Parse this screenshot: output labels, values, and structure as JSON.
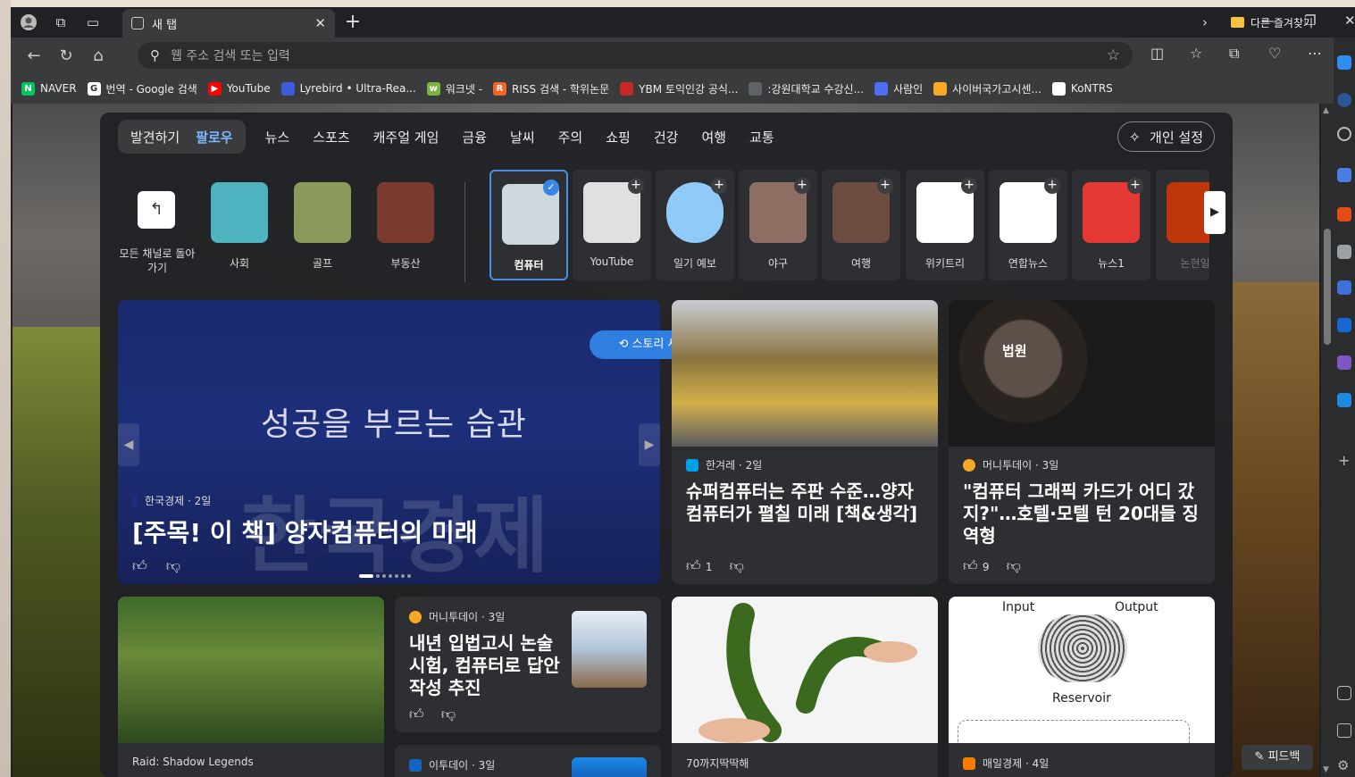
{
  "tab": {
    "title": "새 탭",
    "close": "✕",
    "new": "+"
  },
  "window": {
    "min": "—",
    "max": "❐",
    "close": "✕"
  },
  "omnibox": {
    "placeholder": "웹 주소 검색 또는 입력"
  },
  "favorites": [
    {
      "label": "NAVER",
      "icon_text": "N",
      "color": "#03c75a"
    },
    {
      "label": "번역 - Google 검색",
      "icon_text": "G",
      "color": "#ffffff"
    },
    {
      "label": "YouTube",
      "icon_text": "▶",
      "color": "#ff0000"
    },
    {
      "label": "Lyrebird • Ultra-Rea...",
      "icon_text": "",
      "color": "#3b5bdb"
    },
    {
      "label": "워크넷 -",
      "icon_text": "w",
      "color": "#7cb342"
    },
    {
      "label": "RISS 검색 - 학위논문",
      "icon_text": "R",
      "color": "#f26522"
    },
    {
      "label": "YBM 토익인강 공식...",
      "icon_text": "",
      "color": "#c62828"
    },
    {
      "label": ":강원대학교 수강신...",
      "icon_text": "",
      "color": "#5f6368"
    },
    {
      "label": "사람인",
      "icon_text": "",
      "color": "#4c6ef5"
    },
    {
      "label": "사이버국가고시센...",
      "icon_text": "",
      "color": "#f9a825"
    },
    {
      "label": "KoNTRS",
      "icon_text": "",
      "color": "#ffffff"
    }
  ],
  "favorites_other": "다른 즐겨찾기",
  "nav": {
    "discover": "발견하기",
    "follow": "팔로우",
    "categories": [
      "뉴스",
      "스포츠",
      "캐주얼 게임",
      "금융",
      "날씨",
      "주의",
      "쇼핑",
      "건강",
      "여행",
      "교통"
    ],
    "personalize": "개인 설정"
  },
  "channels": {
    "back_label": "모든 채널로 돌아가기",
    "followed": [
      {
        "label": "사회",
        "color": "#4fb3bf"
      },
      {
        "label": "골프",
        "color": "#8a9a5b"
      },
      {
        "label": "부동산",
        "color": "#7a3b2e"
      }
    ],
    "suggested": [
      {
        "label": "컴퓨터",
        "color": "#cfd8dc",
        "selected": true
      },
      {
        "label": "YouTube",
        "color": "#e0e0e0",
        "selected": false
      },
      {
        "label": "일기 예보",
        "color": "#90caf9",
        "selected": false
      },
      {
        "label": "야구",
        "color": "#8d6e63",
        "selected": false
      },
      {
        "label": "여행",
        "color": "#6d4c41",
        "selected": false
      },
      {
        "label": "위키트리",
        "color": "#ffffff",
        "selected": false
      },
      {
        "label": "연합뉴스",
        "color": "#ffffff",
        "selected": false
      },
      {
        "label": "뉴스1",
        "color": "#e53935",
        "selected": false
      },
      {
        "label": "논현일",
        "color": "#bf360c",
        "selected": false
      }
    ]
  },
  "hero": {
    "image_text": "성공을 부르는 습관",
    "bg_text": "한국경제",
    "source": "한국경제 · 2일",
    "title": "[주목! 이 책] 양자컴퓨터의 미래",
    "refresh": "스토리 새로 고침"
  },
  "cards": [
    {
      "source": "한겨레 · 2일",
      "title": "슈퍼컴퓨터는 주판 수준…양자컴퓨터가 펼칠 미래 [책&생각]",
      "likes": "1",
      "icon_color": "#00a0e9"
    },
    {
      "source": "머니투데이 · 3일",
      "title": "\"컴퓨터 그래픽 카드가 어디 갔지?\"…호텔·모텔 턴 20대들 징역형",
      "likes": "9",
      "icon_color": "#f9a825",
      "image_text": "법원"
    },
    {
      "source": "Raid: Shadow Legends",
      "title": ""
    },
    {
      "source": "머니투데이 · 3일",
      "title": "내년 입법고시 논술시험, 컴퓨터로 답안작성 추진",
      "icon_color": "#f9a825"
    },
    {
      "source": "70까지딱딱해",
      "title": ""
    },
    {
      "source": "매일경제 · 4일",
      "title": "",
      "icon_color": "#f57c00",
      "diagram": {
        "input": "Input",
        "output": "Output",
        "reservoir": "Reservoir"
      }
    },
    {
      "source": "이투데이 · 3일",
      "title": "",
      "icon_color": "#1565c0"
    }
  ],
  "feedback": "피드백"
}
